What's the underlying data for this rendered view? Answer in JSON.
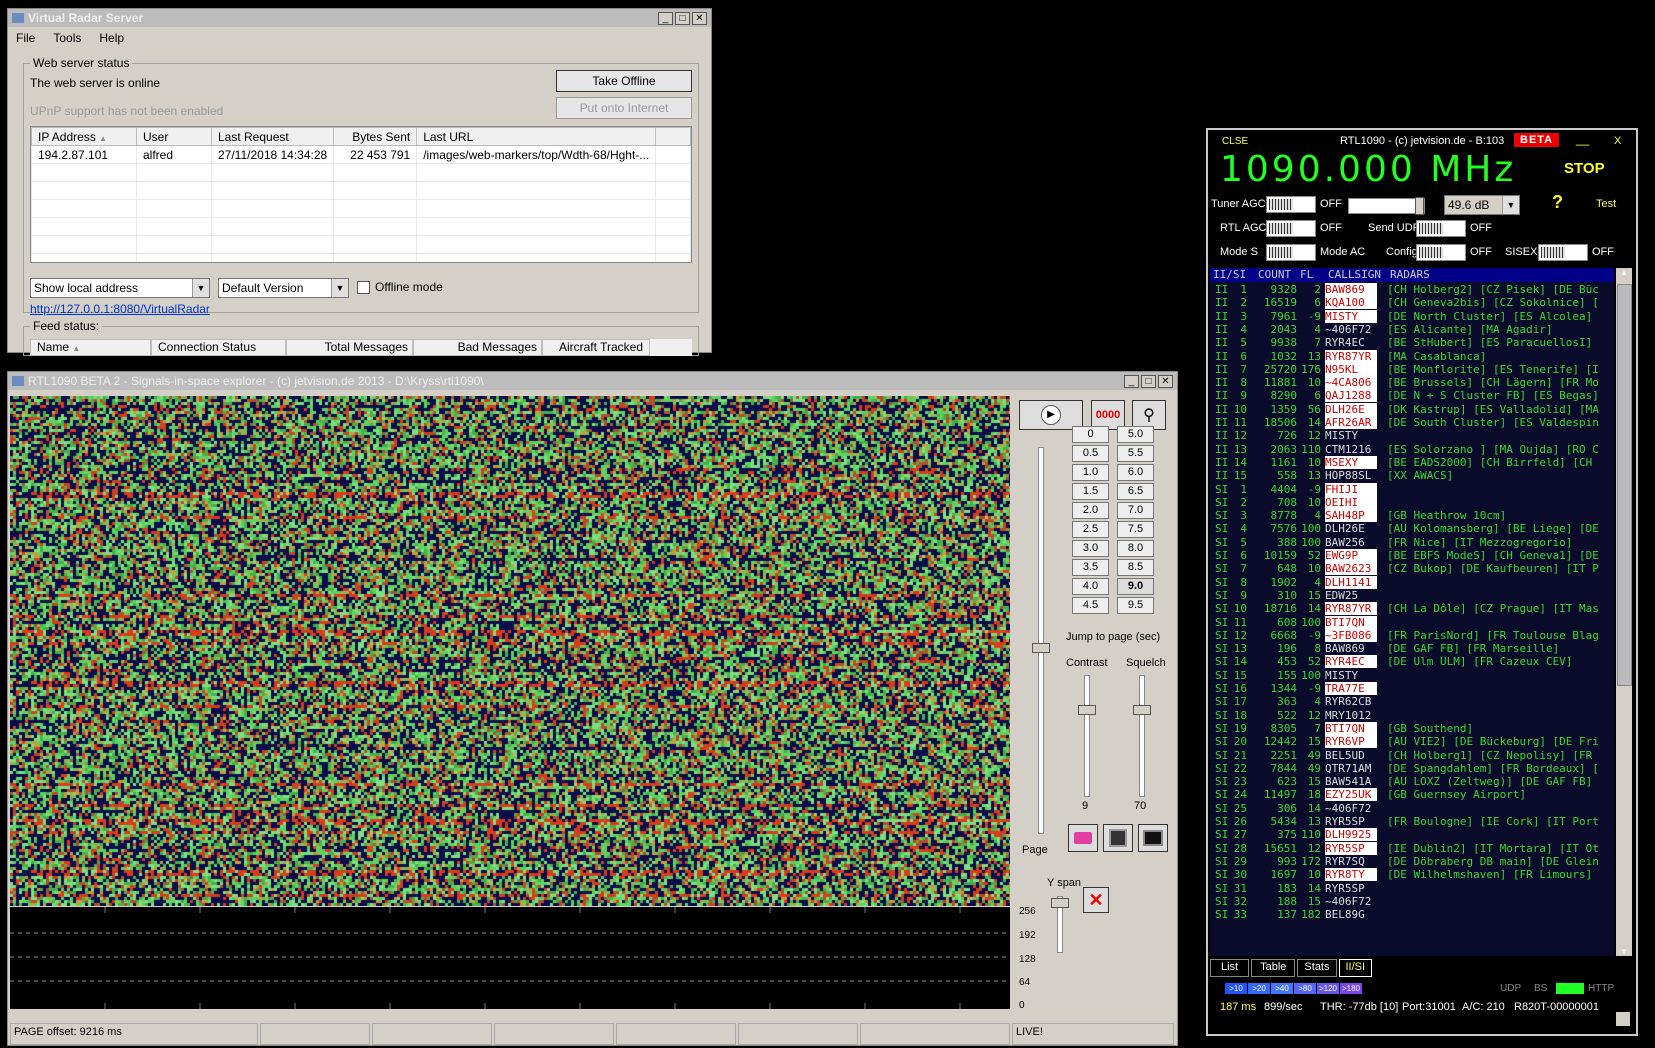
{
  "vrs": {
    "title": "Virtual Radar Server",
    "menu": [
      "File",
      "Tools",
      "Help"
    ],
    "webserver": {
      "legend": "Web server status",
      "status_text": "The web server is online",
      "upnp_text": "UPnP support has not been enabled",
      "take_offline": "Take Offline",
      "put_onto_internet": "Put onto Internet",
      "columns": [
        "IP Address",
        "User",
        "Last Request",
        "Bytes Sent",
        "Last URL"
      ],
      "rows": [
        [
          "194.2.87.101",
          "alfred",
          "27/11/2018 14:34:28",
          "22 453 791",
          "/images/web-markers/top/Wdth-68/Hght-..."
        ]
      ],
      "address_combo": "Show local address",
      "version_combo": "Default Version",
      "offline_mode": "Offline mode",
      "link": "http://127.0.0.1:8080/VirtualRadar"
    },
    "feed": {
      "legend": "Feed status:",
      "columns": [
        "Name",
        "Connection Status",
        "Total Messages",
        "Bad Messages",
        "Aircraft Tracked"
      ]
    }
  },
  "sis": {
    "title": "RTL1090 BETA 2 - Signals-in-space explorer -  (c) jetvision.de 2013 - D:\\Kryss\\rtl1090\\",
    "counter": "0000",
    "page_buttons_left": [
      "0",
      "0.5",
      "1.0",
      "1.5",
      "2.0",
      "2.5",
      "3.0",
      "3.5",
      "4.0",
      "4.5"
    ],
    "page_buttons_right": [
      "5.0",
      "5.5",
      "6.0",
      "6.5",
      "7.0",
      "7.5",
      "8.0",
      "8.5",
      "9.0",
      "9.5"
    ],
    "selected_page": "9.0",
    "jump_label": "Jump to page (sec)",
    "contrast_label": "Contrast",
    "squelch_label": "Squelch",
    "contrast_value": "9",
    "squelch_value": "70",
    "page_label": "Page",
    "y_span_label": "Y span",
    "y_scale": [
      "256",
      "192",
      "128",
      "64",
      "0"
    ],
    "status_offset": "PAGE offset: 9216 ms",
    "status_live": "LIVE!"
  },
  "rtl": {
    "close": "CLSE",
    "title": "RTL1090 - (c) jetvision.de - B:103",
    "beta": "BETA",
    "freq": "1090.000 MHz",
    "stop": "STOP",
    "tuner_agc": "Tuner AGC",
    "rtl_agc": "RTL AGC",
    "mode_s": "Mode S",
    "off": "OFF",
    "gain": "49.6 dB",
    "help": "?",
    "test": "Test",
    "send_udp": "Send UDP",
    "mode_ac": "Mode AC",
    "config": "Config",
    "sisex": "SISEX",
    "header": [
      "II/SI",
      "COUNT",
      "FL",
      "CALLSIGN",
      "RADARS"
    ],
    "rows": [
      [
        "II",
        "1",
        "9328",
        "2",
        "BAW869",
        "[CH Holberg2] [CZ Pisek] [DE Büc",
        true
      ],
      [
        "II",
        "2",
        "16519",
        "6",
        "KQA100",
        "[CH Geneva2bis] [CZ Sokolnice] [",
        true
      ],
      [
        "II",
        "3",
        "7961",
        "-9",
        "MISTY",
        "[DE North Cluster] [ES Alcolea]",
        true
      ],
      [
        "II",
        "4",
        "2043",
        "4",
        "~406F72",
        "[ES Alicante] [MA Agadir]",
        false
      ],
      [
        "II",
        "5",
        "9938",
        "7",
        "RYR4EC",
        "[BE StHubert] [ES ParacuellosI]",
        false
      ],
      [
        "II",
        "6",
        "1032",
        "13",
        "RYR87YR",
        "[MA Casablanca]",
        true
      ],
      [
        "II",
        "7",
        "25720",
        "176",
        "N95KL",
        "[BE Monflorite] [ES Tenerife] [I",
        true
      ],
      [
        "II",
        "8",
        "11881",
        "10",
        "~4CA806",
        "[BE Brussels] [CH Lägern] [FR Mo",
        true
      ],
      [
        "II",
        "9",
        "8290",
        "6",
        "QAJ1288",
        "[DE N + S Cluster FB] [ES Begas]",
        true
      ],
      [
        "II",
        "10",
        "1359",
        "56",
        "DLH26E",
        "[DK Kastrup] [ES Valladolid] [MA",
        true
      ],
      [
        "II",
        "11",
        "18506",
        "14",
        "AFR26AR",
        "[DE South Cluster] [ES Valdespin",
        true
      ],
      [
        "II",
        "12",
        "726",
        "12",
        "MISTY",
        "",
        false
      ],
      [
        "II",
        "13",
        "2063",
        "110",
        "CTM1216",
        "[ES Solorzano ] [MA Oujda] [RO C",
        false
      ],
      [
        "II",
        "14",
        "1161",
        "10",
        "MSEXY",
        "[BE EADS2000] [CH Birrfeld] [CH",
        true
      ],
      [
        "II",
        "15",
        "558",
        "13",
        "HOP88SL",
        "[XX AWACS]",
        false
      ],
      [
        "SI",
        "1",
        "4404",
        "-9",
        "FHIJI",
        "",
        true
      ],
      [
        "SI",
        "2",
        "708",
        "10",
        "OEIHI",
        "",
        true
      ],
      [
        "SI",
        "3",
        "8778",
        "4",
        "SAH48P",
        "[GB Heathrow 10cm]",
        true
      ],
      [
        "SI",
        "4",
        "7576",
        "100",
        "DLH26E",
        "[AU Kolomansberg] [BE Liege] [DE",
        false
      ],
      [
        "SI",
        "5",
        "388",
        "100",
        "BAW256",
        "[FR Nice] [IT Mezzogregorio]",
        false
      ],
      [
        "SI",
        "6",
        "10159",
        "52",
        "EWG9P",
        "[BE EBFS ModeS] [CH Geneva1] [DE",
        true
      ],
      [
        "SI",
        "7",
        "648",
        "10",
        "BAW2623",
        "[CZ Bukop] [DE Kaufbeuren] [IT P",
        true
      ],
      [
        "SI",
        "8",
        "1902",
        "4",
        "DLH1141",
        "",
        true
      ],
      [
        "SI",
        "9",
        "310",
        "15",
        "EDW25",
        "",
        false
      ],
      [
        "SI",
        "10",
        "18716",
        "14",
        "RYR87YR",
        "[CH La Dôle] [CZ Prague] [IT Mas",
        true
      ],
      [
        "SI",
        "11",
        "608",
        "100",
        "BTI7QN",
        "",
        true
      ],
      [
        "SI",
        "12",
        "6668",
        "-9",
        "~3FB086",
        "[FR ParisNord] [FR Toulouse Blag",
        true
      ],
      [
        "SI",
        "13",
        "196",
        "8",
        "BAW869",
        "[DE GAF FB] [FR Marseille]",
        false
      ],
      [
        "SI",
        "14",
        "453",
        "52",
        "RYR4EC",
        "[DE Ulm ULM] [FR Cazeux CEV]",
        true
      ],
      [
        "SI",
        "15",
        "155",
        "100",
        "MISTY",
        "",
        false
      ],
      [
        "SI",
        "16",
        "1344",
        "-9",
        "TRA77E",
        "",
        true
      ],
      [
        "SI",
        "17",
        "363",
        "4",
        "RYR62CB",
        "",
        false
      ],
      [
        "SI",
        "18",
        "522",
        "12",
        "MRY1012",
        "",
        false
      ],
      [
        "SI",
        "19",
        "8305",
        "7",
        "BTI7QN",
        "[GB Southend]",
        true
      ],
      [
        "SI",
        "20",
        "12442",
        "15",
        "RYR6VP",
        "[AU VIE2] [DE Bückeburg] [DE Fri",
        true
      ],
      [
        "SI",
        "21",
        "2251",
        "49",
        "BEL5UD",
        "[CH Holberg1] [CZ Nepolisy] [FR",
        false
      ],
      [
        "SI",
        "22",
        "7844",
        "49",
        "QTR71AM",
        "[DE Spangdahlem] [FR Bordeaux] [",
        false
      ],
      [
        "SI",
        "23",
        "623",
        "15",
        "BAW541A",
        "[AU LOXZ (Zeltweg)] [DE GAF FB]",
        false
      ],
      [
        "SI",
        "24",
        "11497",
        "18",
        "EZY25UK",
        "[GB Guernsey Airport]",
        true
      ],
      [
        "SI",
        "25",
        "306",
        "14",
        "~406F72",
        "",
        false
      ],
      [
        "SI",
        "26",
        "5434",
        "13",
        "RYR5SP",
        "[FR Boulogne] [IE Cork] [IT Port",
        false
      ],
      [
        "SI",
        "27",
        "375",
        "110",
        "DLH9925",
        "",
        true
      ],
      [
        "SI",
        "28",
        "15651",
        "12",
        "RYR5SP",
        "[IE Dublin2] [IT Mortara] [IT Ot",
        true
      ],
      [
        "SI",
        "29",
        "993",
        "172",
        "RYR7SQ",
        "[DE Döbraberg DB main] [DE Glein",
        false
      ],
      [
        "SI",
        "30",
        "1697",
        "10",
        "RYR8TY",
        "[DE Wilhelmshaven] [FR Limours]",
        true
      ],
      [
        "SI",
        "31",
        "183",
        "14",
        "RYR5SP",
        "",
        false
      ],
      [
        "SI",
        "32",
        "188",
        "15",
        "~406F72",
        "",
        false
      ],
      [
        "SI",
        "33",
        "137",
        "182",
        "BEL89G",
        "",
        false
      ]
    ],
    "tabs": [
      "List",
      "Table",
      "Stats",
      "II/SI"
    ],
    "fl_buttons": [
      ">10",
      ">20",
      ">40",
      ">80",
      ">120",
      ">180"
    ],
    "udp": "UDP",
    "bs": "BS",
    "http": "HTTP",
    "status": {
      "ms": "187 ms",
      "rate": "899/sec",
      "thr": "THR: -77db [10]",
      "port": "Port:31001",
      "ac": "A/C: 210",
      "device": "R820T-00000001"
    }
  }
}
